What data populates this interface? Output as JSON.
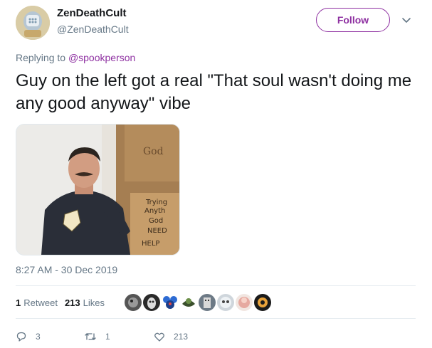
{
  "author": {
    "display_name": "ZenDeathCult",
    "handle": "@ZenDeathCult",
    "avatar_icon": "robot-avatar"
  },
  "header": {
    "follow_label": "Follow",
    "menu_icon": "chevron-down-icon"
  },
  "reply": {
    "prefix": "Replying to ",
    "mention": "@spookperson"
  },
  "tweet": {
    "text": "Guy on the left got a real \"That soul wasn't doing me any good anyway\" vibe",
    "image_sign_lines": [
      "Trying",
      "Anyth",
      "God",
      "NEED",
      "HELP"
    ],
    "image_sign_top": "God"
  },
  "meta": {
    "timestamp": "8:27 AM - 30 Dec 2019"
  },
  "stats": {
    "retweets_count": "1",
    "retweets_label": "Retweet",
    "likes_count": "213",
    "likes_label": "Likes",
    "liker_count_shown": 8
  },
  "actions": {
    "reply_count": "3",
    "retweet_count": "1",
    "like_count": "213"
  },
  "colors": {
    "accent": "#8e30a1",
    "secondary_text": "#657786",
    "primary_text": "#14171a",
    "divider": "#e6ecf0"
  }
}
